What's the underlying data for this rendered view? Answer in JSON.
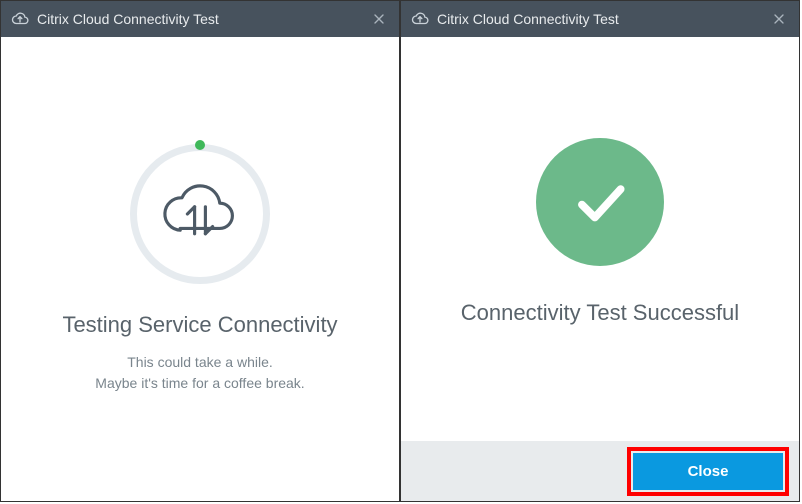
{
  "colors": {
    "titlebar_bg": "#47525d",
    "accent_blue": "#0a99e0",
    "success_green": "#6cb98a",
    "highlight_red": "#ff0000"
  },
  "left": {
    "title": "Citrix Cloud Connectivity Test",
    "heading": "Testing Service Connectivity",
    "sub1": "This could take a while.",
    "sub2": "Maybe it's time for a coffee break."
  },
  "right": {
    "title": "Citrix Cloud Connectivity Test",
    "heading": "Connectivity Test Successful",
    "close_button": "Close"
  }
}
